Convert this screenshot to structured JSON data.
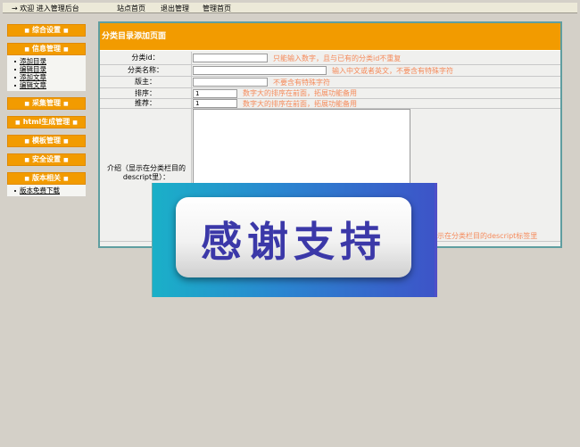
{
  "topbar": {
    "welcome": "→ 欢迎 进入管理后台",
    "nav": [
      "站点首页",
      "退出管理",
      "管理首页"
    ]
  },
  "sidebar": {
    "sections": [
      {
        "label": "综合设置",
        "items": []
      },
      {
        "label": "信息管理",
        "items": [
          "添加目录",
          "编辑目录",
          "添加文章",
          "编辑文章"
        ]
      },
      {
        "label": "采集管理",
        "items": []
      },
      {
        "label": "html生成管理",
        "items": []
      },
      {
        "label": "模板管理",
        "items": []
      },
      {
        "label": "安全设置",
        "items": []
      },
      {
        "label": "版本相关",
        "items": [
          "版本免费下载"
        ]
      }
    ]
  },
  "form": {
    "title": "分类目录添加页面",
    "fields": {
      "id": {
        "label": "分类id：",
        "value": "",
        "hint": "只能输入数字，且与已有的分类id不重复"
      },
      "name": {
        "label": "分类名称：",
        "value": "",
        "hint": "输入中文或者英文，不要含有特殊字符"
      },
      "owner": {
        "label": "版主：",
        "value": "",
        "hint": "不要含有特殊字符"
      },
      "order": {
        "label": "排序：",
        "value": "1",
        "hint": "数字大的排序在前面，拓展功能备用"
      },
      "recommend": {
        "label": "推荐：",
        "value": "1",
        "hint": "数字大的排序在前面，拓展功能备用"
      },
      "desc": {
        "label": "介绍（显示在分类栏目的descript里）：",
        "value": "",
        "hint": "示在分类栏目的descript标签里"
      }
    }
  },
  "overlay": {
    "text": "感谢支持"
  }
}
